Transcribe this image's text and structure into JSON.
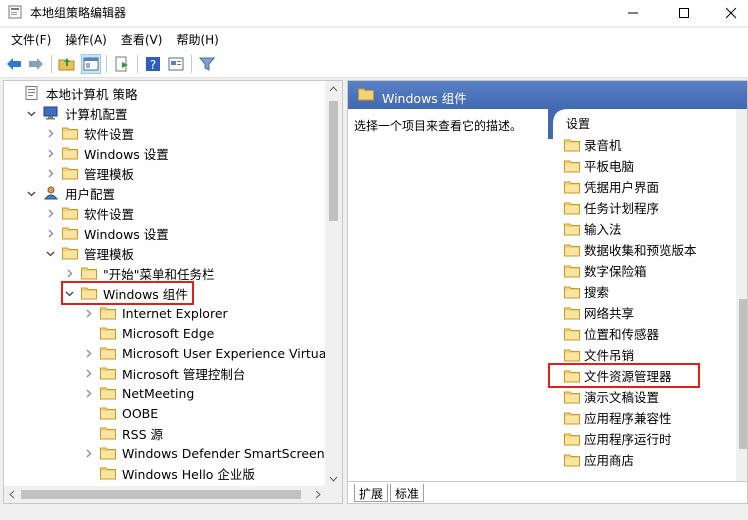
{
  "window": {
    "title": "本地组策略编辑器",
    "icons": [
      "minimize-icon",
      "maximize-icon",
      "close-icon"
    ]
  },
  "menu": [
    "文件(F)",
    "操作(A)",
    "查看(V)",
    "帮助(H)"
  ],
  "toolbar_icons": [
    "back-icon",
    "forward-icon",
    "up-folder-icon",
    "show-hide-tree-icon",
    "export-list-icon",
    "help-icon",
    "properties-view-icon",
    "filter-icon"
  ],
  "tree": [
    {
      "label": "本地计算机 策略",
      "indent": 0,
      "expander": "none",
      "icon": "policy-icon"
    },
    {
      "label": "计算机配置",
      "indent": 1,
      "expander": "open",
      "icon": "computer-icon"
    },
    {
      "label": "软件设置",
      "indent": 2,
      "expander": "closed",
      "icon": "folder-icon"
    },
    {
      "label": "Windows 设置",
      "indent": 2,
      "expander": "closed",
      "icon": "folder-icon"
    },
    {
      "label": "管理模板",
      "indent": 2,
      "expander": "closed",
      "icon": "folder-icon"
    },
    {
      "label": "用户配置",
      "indent": 1,
      "expander": "open",
      "icon": "user-icon"
    },
    {
      "label": "软件设置",
      "indent": 2,
      "expander": "closed",
      "icon": "folder-icon"
    },
    {
      "label": "Windows 设置",
      "indent": 2,
      "expander": "closed",
      "icon": "folder-icon"
    },
    {
      "label": "管理模板",
      "indent": 2,
      "expander": "open",
      "icon": "folder-icon"
    },
    {
      "label": "\"开始\"菜单和任务栏",
      "indent": 3,
      "expander": "closed",
      "icon": "folder-icon"
    },
    {
      "label": "Windows 组件",
      "indent": 3,
      "expander": "open",
      "icon": "folder-icon",
      "selected": true
    },
    {
      "label": "Internet Explorer",
      "indent": 4,
      "expander": "closed",
      "icon": "folder-icon"
    },
    {
      "label": "Microsoft Edge",
      "indent": 4,
      "expander": "none",
      "icon": "folder-icon"
    },
    {
      "label": "Microsoft User Experience Virtualizatio",
      "indent": 4,
      "expander": "closed",
      "icon": "folder-icon"
    },
    {
      "label": "Microsoft 管理控制台",
      "indent": 4,
      "expander": "closed",
      "icon": "folder-icon"
    },
    {
      "label": "NetMeeting",
      "indent": 4,
      "expander": "closed",
      "icon": "folder-icon"
    },
    {
      "label": "OOBE",
      "indent": 4,
      "expander": "none",
      "icon": "folder-icon"
    },
    {
      "label": "RSS 源",
      "indent": 4,
      "expander": "none",
      "icon": "folder-icon"
    },
    {
      "label": "Windows Defender SmartScreen",
      "indent": 4,
      "expander": "closed",
      "icon": "folder-icon"
    },
    {
      "label": "Windows Hello 企业版",
      "indent": 4,
      "expander": "none",
      "icon": "folder-icon"
    }
  ],
  "right": {
    "header_title": "Windows 组件",
    "description": "选择一个项目来查看它的描述。",
    "list_header": "设置",
    "items": [
      {
        "label": "录音机"
      },
      {
        "label": "平板电脑"
      },
      {
        "label": "凭据用户界面"
      },
      {
        "label": "任务计划程序"
      },
      {
        "label": "输入法"
      },
      {
        "label": "数据收集和预览版本"
      },
      {
        "label": "数字保险箱"
      },
      {
        "label": "搜索"
      },
      {
        "label": "网络共享"
      },
      {
        "label": "位置和传感器"
      },
      {
        "label": "文件吊销"
      },
      {
        "label": "文件资源管理器",
        "highlighted": true
      },
      {
        "label": "演示文稿设置"
      },
      {
        "label": "应用程序兼容性"
      },
      {
        "label": "应用程序运行时"
      },
      {
        "label": "应用商店"
      }
    ],
    "tabs": [
      "扩展",
      "标准"
    ]
  },
  "colors": {
    "folder": "#e8c15a",
    "header_blue": "#4a6fb5",
    "highlight_red": "#e0201c"
  }
}
